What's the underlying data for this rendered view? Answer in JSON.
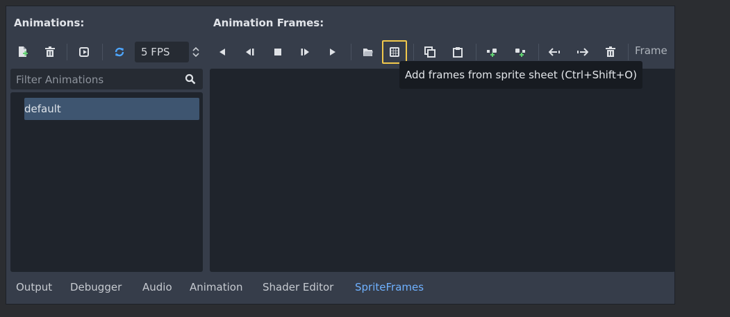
{
  "sections": {
    "animations_label": "Animations:",
    "frames_label": "Animation Frames:"
  },
  "toolbar": {
    "fps_value": "5 FPS",
    "frame_label": "Frame",
    "icons": [
      "new-animation-icon",
      "delete-animation-icon",
      "autoplay-icon",
      "loop-icon",
      "play-backwards-icon",
      "play-backwards-from-start-icon",
      "stop-icon",
      "play-from-start-icon",
      "play-icon",
      "load-icon",
      "sprite-sheet-grid-icon",
      "copy-icon",
      "paste-icon",
      "insert-before-icon",
      "insert-after-icon",
      "move-left-icon",
      "move-right-icon",
      "delete-frame-icon"
    ]
  },
  "filter": {
    "placeholder": "Filter Animations"
  },
  "animations": {
    "items": [
      "default"
    ]
  },
  "tooltip": {
    "text": "Add frames from sprite sheet (Ctrl+Shift+O)"
  },
  "bottom_tabs": {
    "output": "Output",
    "debugger": "Debugger",
    "audio": "Audio",
    "animation": "Animation",
    "shader_editor": "Shader Editor",
    "sprite_frames": "SpriteFrames"
  },
  "colors": {
    "accent": "#6fb1ff",
    "highlight": "#f2c94c",
    "loop_icon": "#4ea6ff",
    "add_green": "#5fd070"
  }
}
